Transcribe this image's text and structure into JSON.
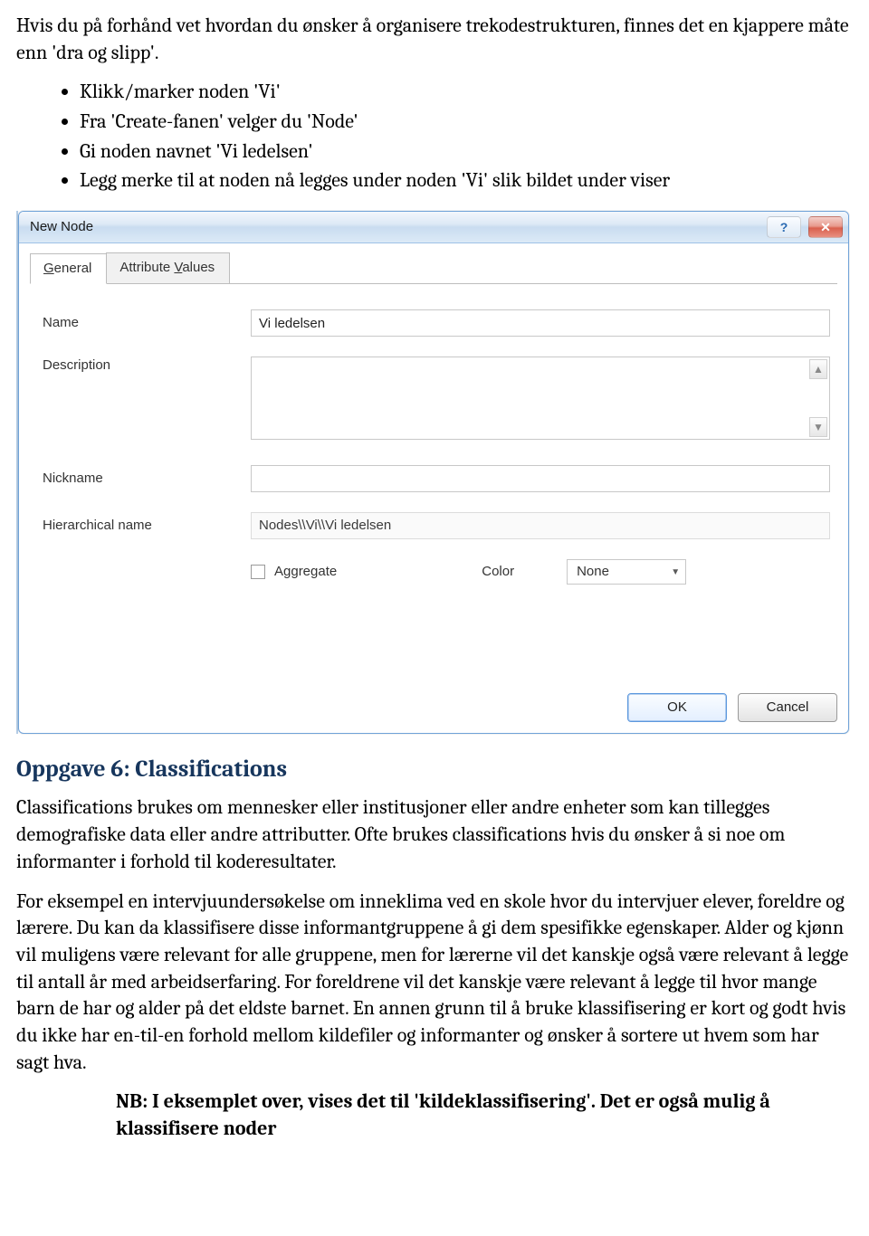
{
  "intro": "Hvis du på forhånd vet hvordan du ønsker å organisere trekodestrukturen, finnes det en kjappere måte enn 'dra og slipp'.",
  "steps": [
    "Klikk/marker noden 'Vi'",
    "Fra 'Create-fanen' velger du 'Node'",
    "Gi noden navnet 'Vi ledelsen'",
    "Legg merke til at noden nå legges under noden 'Vi' slik bildet under viser"
  ],
  "dialog": {
    "title": "New Node",
    "tabs": {
      "general": "General",
      "attrvals": "Attribute Values",
      "generalMnemonic": "G",
      "attrMnemonic": "V"
    },
    "labels": {
      "name": "Name",
      "description": "Description",
      "nickname": "Nickname",
      "hier": "Hierarchical name",
      "aggregate": "Aggregate",
      "color": "Color"
    },
    "values": {
      "name": "Vi ledelsen",
      "nickname": "",
      "hier": "Nodes\\\\Vi\\\\Vi ledelsen",
      "colorSelected": "None"
    },
    "buttons": {
      "ok": "OK",
      "cancel": "Cancel"
    }
  },
  "section6": {
    "title": "Oppgave 6: Classifications",
    "p1": "Classifications brukes om mennesker eller institusjoner eller andre enheter som kan tillegges demografiske data eller andre attributter. Ofte brukes classifications hvis du ønsker å si noe om informanter i forhold til koderesultater.",
    "p2": "For eksempel en intervjuundersøkelse om inneklima ved en skole hvor du intervjuer elever, foreldre og lærere. Du kan da klassifisere disse informantgruppene å gi dem spesifikke egenskaper. Alder og kjønn vil muligens være relevant for alle gruppene, men for lærerne vil det kanskje også være relevant å legge til antall år med arbeidserfaring. For foreldrene vil det kanskje være relevant å legge til hvor mange barn de har og alder på det eldste barnet. En annen grunn til å bruke klassifisering er kort og godt hvis du ikke har en-til-en forhold mellom kildefiler og informanter og ønsker å sortere ut hvem som har sagt hva.",
    "note": "NB: I eksemplet over, vises det til 'kildeklassifisering'. Det er også mulig å klassifisere noder"
  }
}
